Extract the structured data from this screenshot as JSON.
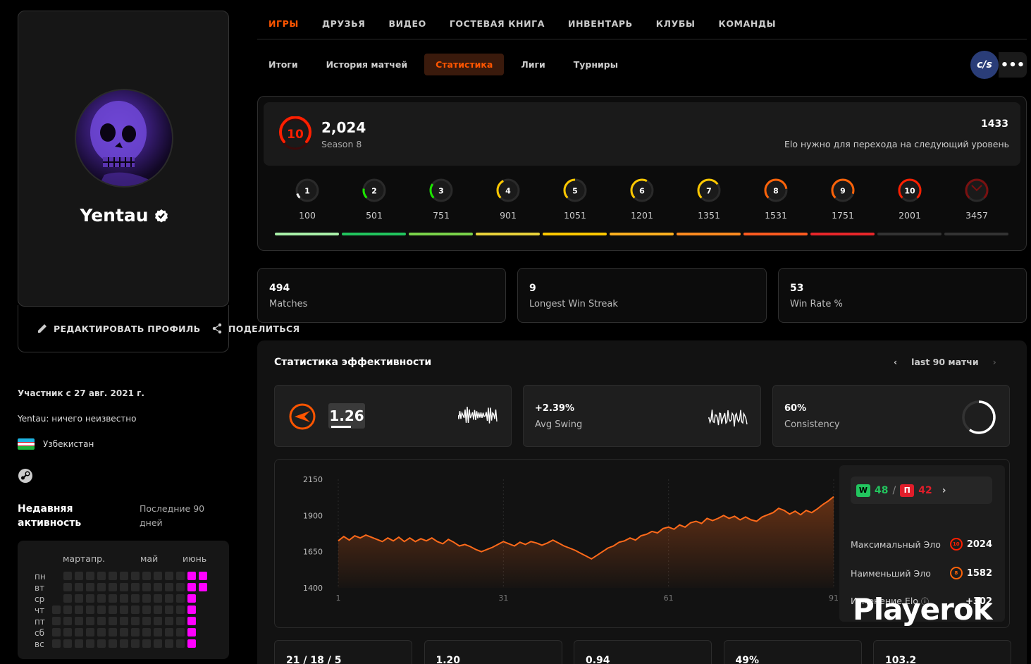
{
  "profile": {
    "username": "Yentau",
    "edit_label": "РЕДАКТИРОВАТЬ ПРОФИЛЬ",
    "share_label": "ПОДЕЛИТЬСЯ",
    "member_since": "Участник с 27 авг. 2021 г.",
    "bio": "Yentau: ничего неизвестно",
    "country": "Узбекистан"
  },
  "activity": {
    "title": "Недавняя активность",
    "subtitle": "Последние 90 дней",
    "months": [
      "мартапр.",
      "май",
      "июнь"
    ],
    "days": [
      "пн",
      "вт",
      "ср",
      "чт",
      "пт",
      "сб",
      "вс"
    ]
  },
  "nav": {
    "top": [
      "ИГРЫ",
      "ДРУЗЬЯ",
      "ВИДЕО",
      "ГОСТЕВАЯ КНИГА",
      "ИНВЕНТАРЬ",
      "КЛУБЫ",
      "КОМАНДЫ"
    ],
    "sub": [
      "Итоги",
      "История матчей",
      "Статистика",
      "Лиги",
      "Турниры"
    ],
    "game": "cs",
    "more": "•••"
  },
  "elo": {
    "level": "10",
    "value": "2,024",
    "season": "Season 8",
    "next_value": "1433",
    "next_text": "Elo нужно для перехода на следующий уровень",
    "levels": [
      {
        "n": "1",
        "elo": "100",
        "color": "#eeeeee"
      },
      {
        "n": "2",
        "elo": "501",
        "color": "#1ce400"
      },
      {
        "n": "3",
        "elo": "751",
        "color": "#1ce400"
      },
      {
        "n": "4",
        "elo": "901",
        "color": "#ffc800"
      },
      {
        "n": "5",
        "elo": "1051",
        "color": "#ffc800"
      },
      {
        "n": "6",
        "elo": "1201",
        "color": "#ffc800"
      },
      {
        "n": "7",
        "elo": "1351",
        "color": "#ffc800"
      },
      {
        "n": "8",
        "elo": "1531",
        "color": "#ff6309"
      },
      {
        "n": "9",
        "elo": "1751",
        "color": "#ff6309"
      },
      {
        "n": "10",
        "elo": "2001",
        "color": "#fe1f00"
      },
      {
        "n": "",
        "elo": "3457",
        "color": "#7a1010"
      }
    ]
  },
  "stats": {
    "matches": "494",
    "matches_label": "Matches",
    "streak": "9",
    "streak_label": "Longest Win Streak",
    "winrate": "53",
    "winrate_label": "Win Rate %"
  },
  "perf": {
    "title": "Статистика эффективности",
    "range": "last 90 матчи",
    "rating": "1.26",
    "swing": "+2.39%",
    "swing_label": "Avg Swing",
    "consistency": "60%",
    "consistency_label": "Consistency",
    "consistency_pct": 60
  },
  "side": {
    "wins": "48",
    "losses": "42",
    "win_badge": "W",
    "loss_badge": "П",
    "max_label": "Максимальный Эло",
    "max_val": "2024",
    "max_lvl": "10",
    "min_label": "Наименьший Эло",
    "min_val": "1582",
    "min_lvl": "8",
    "change_label": "Изменение Elo",
    "change_val": "+302"
  },
  "watermark": "Playerok",
  "bottom": [
    "21 / 18 / 5",
    "1.20",
    "0.94",
    "49%",
    "103.2"
  ],
  "chart_data": {
    "type": "area",
    "xlabel": "",
    "ylabel": "",
    "x_ticks": [
      "1",
      "31",
      "61",
      "91"
    ],
    "y_ticks": [
      "2150",
      "1900",
      "1650",
      "1400"
    ],
    "ylim": [
      1400,
      2150
    ],
    "xlim": [
      1,
      91
    ],
    "color": "#ff6a1a",
    "values": [
      1725,
      1755,
      1730,
      1760,
      1745,
      1765,
      1750,
      1735,
      1720,
      1745,
      1725,
      1750,
      1720,
      1745,
      1720,
      1740,
      1725,
      1745,
      1720,
      1705,
      1735,
      1715,
      1690,
      1700,
      1685,
      1665,
      1650,
      1665,
      1680,
      1700,
      1720,
      1705,
      1690,
      1715,
      1700,
      1720,
      1710,
      1695,
      1710,
      1730,
      1710,
      1690,
      1675,
      1660,
      1640,
      1620,
      1600,
      1625,
      1650,
      1675,
      1690,
      1715,
      1725,
      1745,
      1730,
      1760,
      1770,
      1790,
      1780,
      1810,
      1820,
      1805,
      1835,
      1820,
      1850,
      1860,
      1845,
      1880,
      1865,
      1880,
      1900,
      1880,
      1895,
      1870,
      1890,
      1870,
      1860,
      1890,
      1905,
      1920,
      1950,
      1935,
      1910,
      1930,
      1905,
      1935,
      1920,
      1945,
      1975,
      2000,
      2030
    ]
  }
}
